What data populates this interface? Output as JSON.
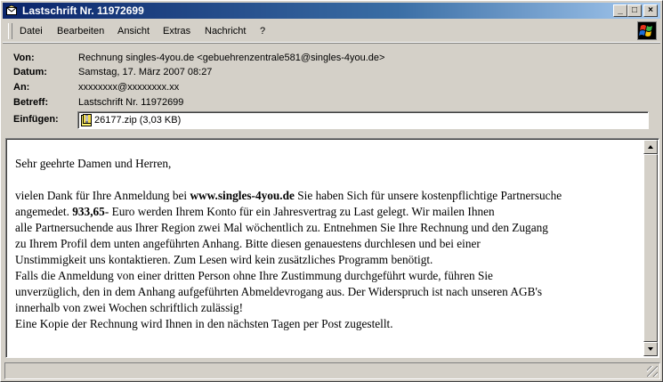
{
  "window": {
    "title": "Lastschrift Nr. 11972699",
    "minimize_glyph": "_",
    "maximize_glyph": "□",
    "close_glyph": "×"
  },
  "menu": {
    "items": [
      "Datei",
      "Bearbeiten",
      "Ansicht",
      "Extras",
      "Nachricht",
      "?"
    ]
  },
  "header": {
    "from_label": "Von:",
    "from_value": "Rechnung singles-4you.de <gebuehrenzentrale581@singles-4you.de>",
    "date_label": "Datum:",
    "date_value": "Samstag, 17. März 2007 08:27",
    "to_label": "An:",
    "to_value": "xxxxxxxx@xxxxxxxx.xx",
    "subject_label": "Betreff:",
    "subject_value": "Lastschrift Nr. 11972699",
    "attach_label": "Einfügen:",
    "attach_value": "26177.zip (3,03 KB)"
  },
  "body": {
    "greeting": "Sehr geehrte Damen und Herren,",
    "l1_a": "vielen Dank für Ihre Anmeldung bei ",
    "l1_b": "www.singles-4you.de",
    "l1_c": " Sie haben Sich für unsere kostenpflichtige Partnersuche",
    "l2_a": "angemedet. ",
    "l2_b": "933,65",
    "l2_c": "- Euro werden Ihrem Konto für ein Jahresvertrag zu Last gelegt. Wir mailen Ihnen",
    "l3": "alle Partnersuchende aus Ihrer Region zwei Mal wöchentlich zu. Entnehmen Sie Ihre Rechnung und den Zugang",
    "l4": "zu Ihrem Profil dem unten angeführten Anhang. Bitte diesen genauestens durchlesen und bei einer",
    "l5": "Unstimmigkeit uns kontaktieren. Zum Lesen wird kein zusätzliches Programm benötigt.",
    "l6": "Falls die Anmeldung von einer dritten Person ohne Ihre Zustimmung durchgeführt wurde, führen Sie",
    "l7": "unverzüglich, den in dem Anhang aufgeführten Abmeldevrogang aus. Der Widerspruch ist nach unseren AGB's",
    "l8": "innerhalb von zwei Wochen schriftlich zulässig!",
    "l9": "Eine Kopie der Rechnung wird Ihnen in den nächsten Tagen per Post zugestellt."
  },
  "statusbar": {
    "text": ""
  },
  "colors": {
    "titlebar_start": "#0a246a",
    "titlebar_end": "#a6caf0",
    "chrome": "#d4d0c8"
  }
}
